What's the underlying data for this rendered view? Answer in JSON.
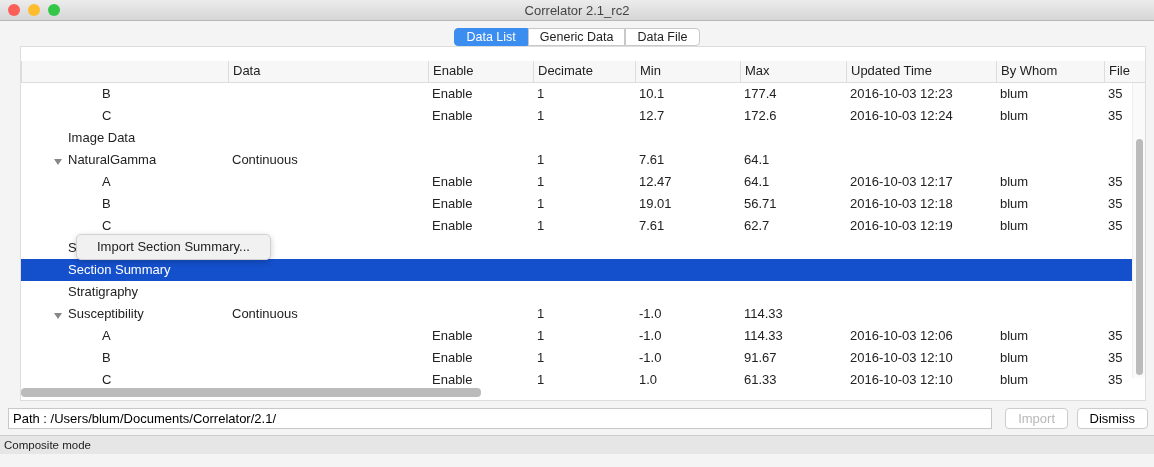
{
  "window": {
    "title": "Correlator 2.1_rc2"
  },
  "tabs": [
    {
      "label": "Data List",
      "selected": true
    },
    {
      "label": "Generic Data",
      "selected": false
    },
    {
      "label": "Data File",
      "selected": false
    }
  ],
  "table": {
    "columns": [
      "Data",
      "Enable",
      "Decimate",
      "Min",
      "Max",
      "Updated Time",
      "By Whom",
      "File"
    ],
    "rows": [
      {
        "children": [
          {
            "name": "B",
            "selected": false,
            "enable": "Enable",
            "decimate": "1",
            "min": "10.1",
            "max": "177.4",
            "updated_time": "2016-10-03 12:23",
            "by_whom": "blum",
            "file": "35"
          },
          {
            "name": "C",
            "selected": false,
            "enable": "Enable",
            "decimate": "1",
            "min": "12.7",
            "max": "172.6",
            "updated_time": "2016-10-03 12:24",
            "by_whom": "blum",
            "file": "35"
          }
        ]
      },
      {
        "name": "Image Data",
        "selected": false
      },
      {
        "name": "NaturalGamma",
        "selected": false,
        "expanded": true,
        "data": "Continuous",
        "decimate": "1",
        "min": "7.61",
        "max": "64.1",
        "children": [
          {
            "name": "A",
            "selected": false,
            "enable": "Enable",
            "decimate": "1",
            "min": "12.47",
            "max": "64.1",
            "updated_time": "2016-10-03 12:17",
            "by_whom": "blum",
            "file": "35"
          },
          {
            "name": "B",
            "selected": false,
            "enable": "Enable",
            "decimate": "1",
            "min": "19.01",
            "max": "56.71",
            "updated_time": "2016-10-03 12:18",
            "by_whom": "blum",
            "file": "35"
          },
          {
            "name": "C",
            "selected": false,
            "enable": "Enable",
            "decimate": "1",
            "min": "7.61",
            "max": "62.7",
            "updated_time": "2016-10-03 12:19",
            "by_whom": "blum",
            "file": "35"
          }
        ]
      },
      {
        "name": "S",
        "selected": false,
        "context_menu": {
          "items": [
            "Import Section Summary..."
          ]
        }
      },
      {
        "name": "Section Summary",
        "selected": true
      },
      {
        "name": "Stratigraphy",
        "selected": false
      },
      {
        "name": "Susceptibility",
        "selected": false,
        "expanded": true,
        "data": "Continuous",
        "decimate": "1",
        "min": "-1.0",
        "max": "114.33",
        "children": [
          {
            "name": "A",
            "selected": false,
            "enable": "Enable",
            "decimate": "1",
            "min": "-1.0",
            "max": "114.33",
            "updated_time": "2016-10-03 12:06",
            "by_whom": "blum",
            "file": "35"
          },
          {
            "name": "B",
            "selected": false,
            "enable": "Enable",
            "decimate": "1",
            "min": "-1.0",
            "max": "91.67",
            "updated_time": "2016-10-03 12:10",
            "by_whom": "blum",
            "file": "35"
          },
          {
            "name": "C",
            "selected": false,
            "enable": "Enable",
            "decimate": "1",
            "min": "1.0",
            "max": "61.33",
            "updated_time": "2016-10-03 12:10",
            "by_whom": "blum",
            "file": "35"
          }
        ]
      }
    ]
  },
  "path_field": {
    "value": "Path : /Users/blum/Documents/Correlator/2.1/"
  },
  "buttons": [
    {
      "label": "Import",
      "disabled": true
    },
    {
      "label": "Dismiss",
      "disabled": false
    }
  ],
  "status_bar": "Composite mode"
}
